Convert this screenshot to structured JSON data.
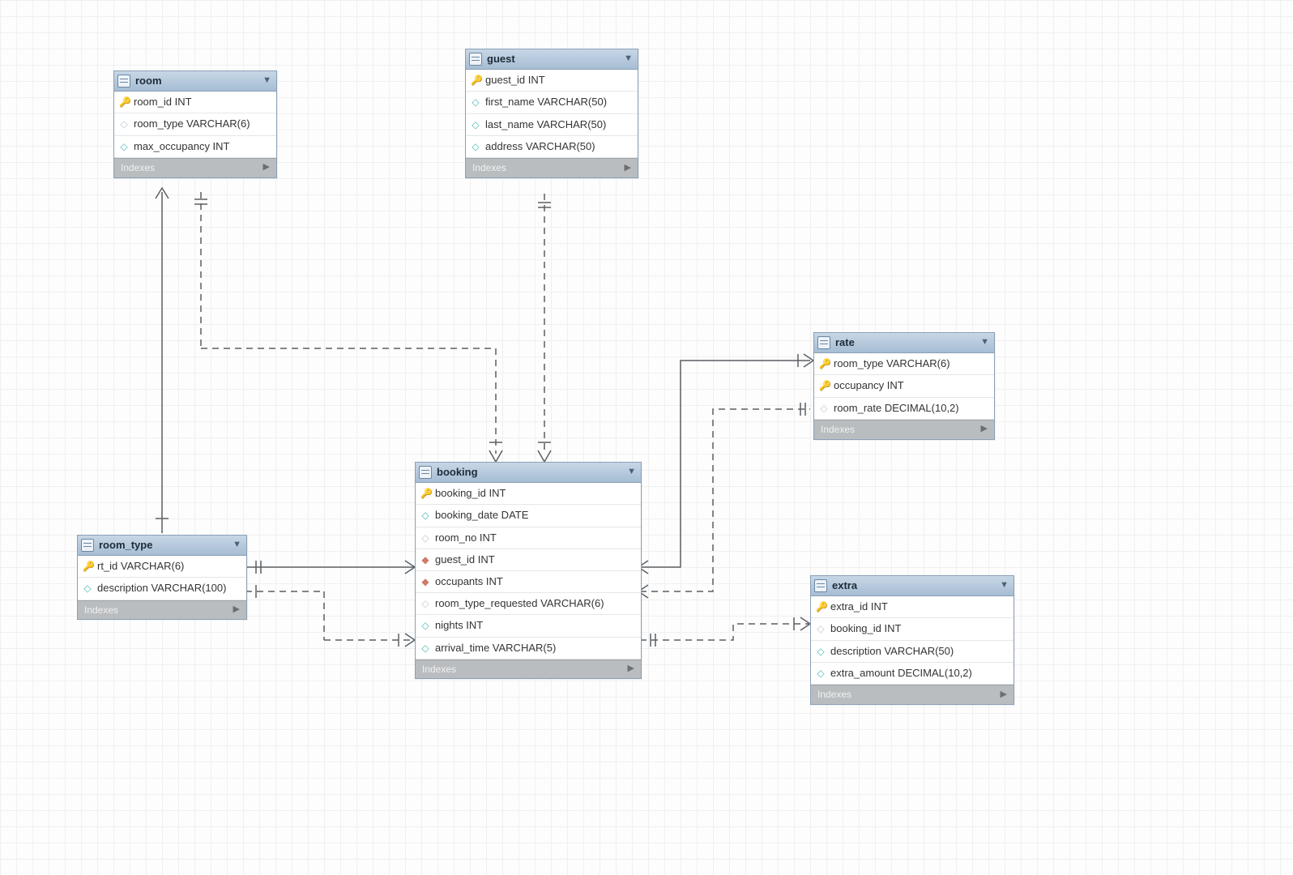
{
  "tables": {
    "room": {
      "name": "room",
      "columns": [
        {
          "icon": "key",
          "label": "room_id INT"
        },
        {
          "icon": "dwhite",
          "label": "room_type VARCHAR(6)"
        },
        {
          "icon": "dteal",
          "label": "max_occupancy INT"
        }
      ]
    },
    "guest": {
      "name": "guest",
      "columns": [
        {
          "icon": "key",
          "label": "guest_id INT"
        },
        {
          "icon": "dteal",
          "label": "first_name VARCHAR(50)"
        },
        {
          "icon": "dteal",
          "label": "last_name VARCHAR(50)"
        },
        {
          "icon": "dteal",
          "label": "address VARCHAR(50)"
        }
      ]
    },
    "rate": {
      "name": "rate",
      "columns": [
        {
          "icon": "keyred",
          "label": "room_type VARCHAR(6)"
        },
        {
          "icon": "key",
          "label": "occupancy INT"
        },
        {
          "icon": "dwhite",
          "label": "room_rate DECIMAL(10,2)"
        }
      ]
    },
    "room_type": {
      "name": "room_type",
      "columns": [
        {
          "icon": "key",
          "label": "rt_id VARCHAR(6)"
        },
        {
          "icon": "dteal",
          "label": "description VARCHAR(100)"
        }
      ]
    },
    "booking": {
      "name": "booking",
      "columns": [
        {
          "icon": "key",
          "label": "booking_id INT"
        },
        {
          "icon": "dteal",
          "label": "booking_date DATE"
        },
        {
          "icon": "dwhite",
          "label": "room_no INT"
        },
        {
          "icon": "dfill",
          "label": "guest_id INT"
        },
        {
          "icon": "dfill",
          "label": "occupants INT"
        },
        {
          "icon": "dwhite",
          "label": "room_type_requested VARCHAR(6)"
        },
        {
          "icon": "dteal",
          "label": "nights INT"
        },
        {
          "icon": "dwhite",
          "label": "arrival_time VARCHAR(5)"
        }
      ]
    },
    "extra": {
      "name": "extra",
      "columns": [
        {
          "icon": "key",
          "label": "extra_id INT"
        },
        {
          "icon": "dwhite",
          "label": "booking_id INT"
        },
        {
          "icon": "dteal",
          "label": "description VARCHAR(50)"
        },
        {
          "icon": "dteal",
          "label": "extra_amount DECIMAL(10,2)"
        }
      ]
    }
  },
  "indexes_label": "Indexes",
  "relationships": [
    {
      "from": "booking.room_no",
      "to": "room.room_id",
      "style": "dashed"
    },
    {
      "from": "booking.guest_id",
      "to": "guest.guest_id",
      "style": "dashed"
    },
    {
      "from": "booking.room_type_requested",
      "to": "room_type.rt_id",
      "style": "dashed"
    },
    {
      "from": "booking.room_no",
      "to": "room_type.rt_id",
      "style": "solid"
    },
    {
      "from": "room.room_type",
      "to": "room_type.rt_id",
      "style": "solid_dashed"
    },
    {
      "from": "rate.room_type",
      "to": "booking",
      "style": "solid"
    },
    {
      "from": "rate.room_type",
      "to": "booking",
      "style": "dashed"
    },
    {
      "from": "extra.booking_id",
      "to": "booking.booking_id",
      "style": "dashed"
    }
  ]
}
